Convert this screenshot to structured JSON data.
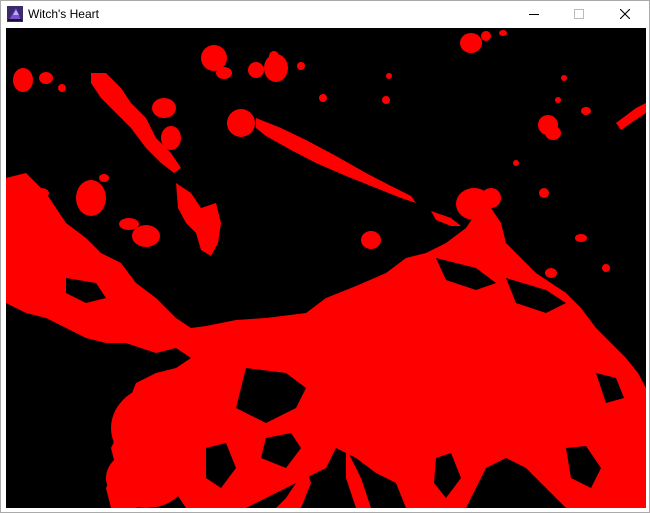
{
  "window": {
    "title": "Witch's Heart"
  },
  "icons": {
    "app": "witch-hat-app-icon",
    "minimize": "minimize-icon",
    "maximize": "maximize-icon",
    "close": "close-icon"
  },
  "colors": {
    "canvas_background": "#000000",
    "blood": "#ff0000",
    "titlebar": "#ffffff",
    "title_text": "#000000"
  }
}
